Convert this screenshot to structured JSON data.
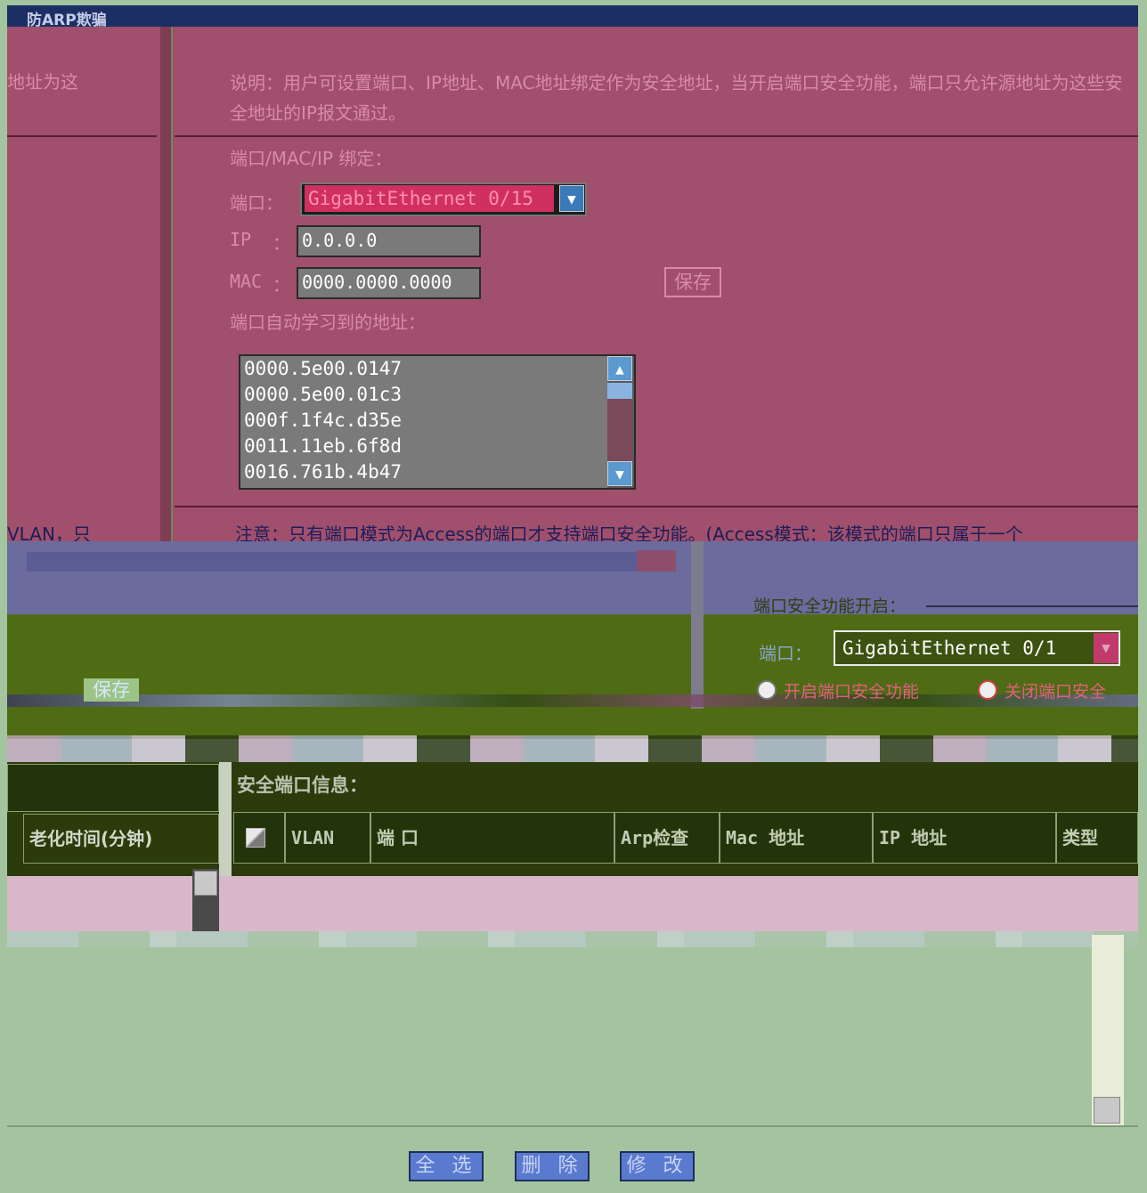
{
  "header": {
    "title": "防ARP欺骗"
  },
  "description": {
    "left_fragment": "地址为这",
    "text": "说明：用户可设置端口、IP地址、MAC地址绑定作为安全地址，当开启端口安全功能，端口只允许源地址为这些安全地址的IP报文通过。"
  },
  "binding": {
    "section_label": "端口/MAC/IP 绑定：",
    "port_label": "端口：",
    "port_value": "GigabitEthernet 0/15",
    "ip_label": "IP",
    "ip_colon": "：",
    "ip_value": "0.0.0.0",
    "mac_label": "MAC",
    "mac_colon": "：",
    "mac_value": "0000.0000.0000",
    "save_label": "保存",
    "learned_label": "端口自动学习到的地址：",
    "learned_addresses": [
      "0000.5e00.0147",
      "0000.5e00.01c3",
      "000f.1f4c.d35e",
      "0011.11eb.6f8d",
      "0016.761b.4b47"
    ]
  },
  "note": {
    "left_fragment": "VLAN，只",
    "text": "注意：只有端口模式为Access的端口才支持端口安全功能。(Access模式：该模式的端口只属于一个"
  },
  "port_security": {
    "subtitle": "端口安全功能开启：",
    "port_label": "端口：",
    "port_value": "GigabitEthernet 0/1",
    "save_label": "保存",
    "enable_label": "开启端口安全功能",
    "disable_label": "关闭端口安全"
  },
  "table": {
    "left_column": "老化时间(分钟)",
    "title": "安全端口信息：",
    "columns": [
      "VLAN",
      "端 口",
      "Arp检查",
      "Mac 地址",
      "IP 地址",
      "类型"
    ]
  },
  "actions": {
    "select_all": "全 选",
    "delete": "删 除",
    "modify": "修 改"
  },
  "colors": {
    "pink_bg": "#a0506c",
    "olive_bg": "#4f6b14",
    "table_bg": "#2b3b0b",
    "green_bg": "#a4c4a0"
  }
}
